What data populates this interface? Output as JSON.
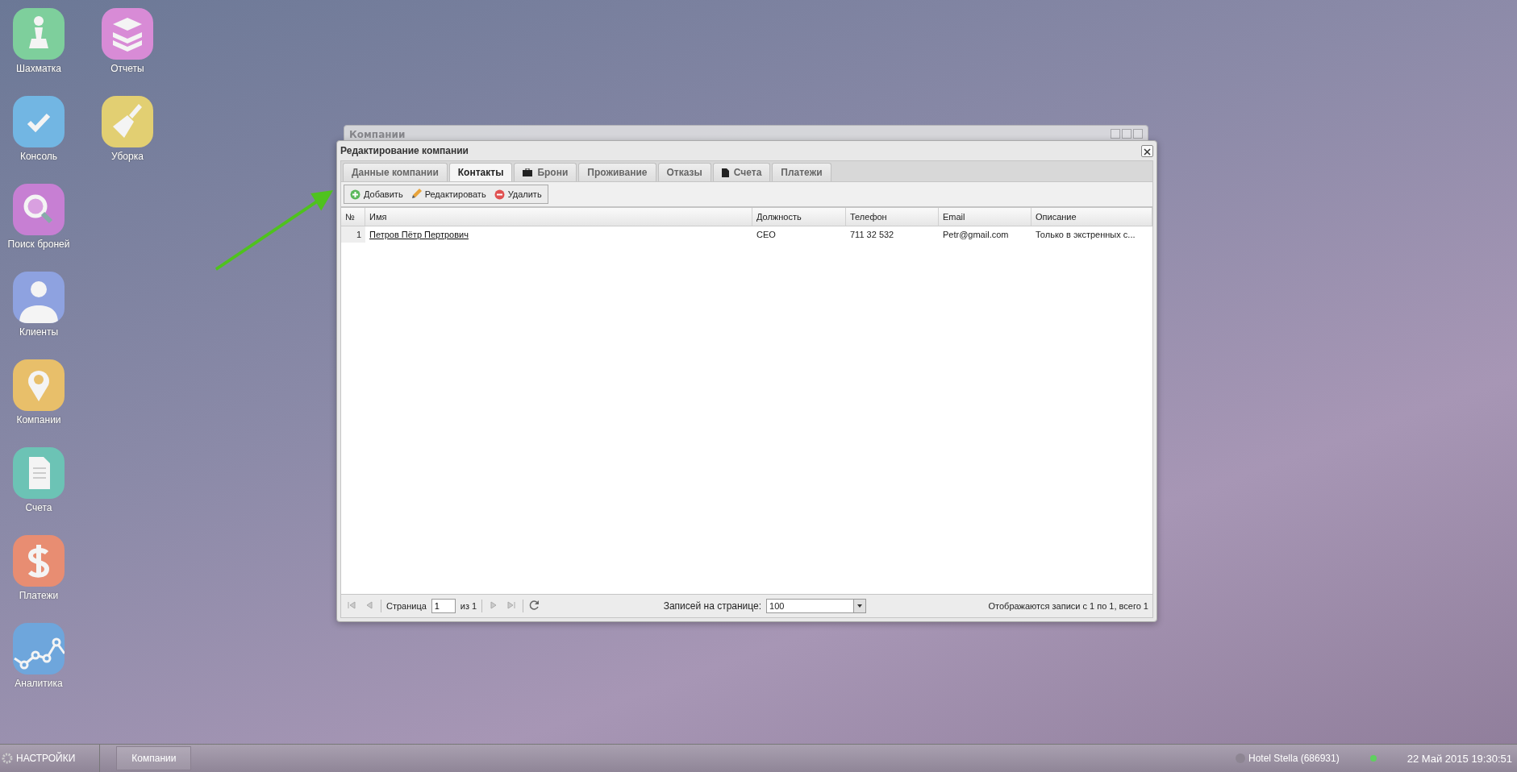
{
  "desktop_columns": [
    {
      "icons": [
        {
          "label": "Шахматка",
          "kind": "pawn"
        },
        {
          "label": "Консоль",
          "kind": "check"
        },
        {
          "label": "Поиск броней",
          "kind": "magnifier"
        },
        {
          "label": "Клиенты",
          "kind": "person"
        },
        {
          "label": "Компании",
          "kind": "pin"
        },
        {
          "label": "Счета",
          "kind": "document"
        },
        {
          "label": "Платежи",
          "kind": "dollar"
        },
        {
          "label": "Аналитика",
          "kind": "chart"
        }
      ]
    },
    {
      "icons": [
        {
          "label": "Отчеты",
          "kind": "books"
        },
        {
          "label": "Уборка",
          "kind": "broom"
        }
      ]
    }
  ],
  "background_window": {
    "title": "Компании"
  },
  "edit_window": {
    "title": "Редактирование компании",
    "tabs": [
      {
        "label": "Данные компании",
        "kind": "plain",
        "selected": false
      },
      {
        "label": "Контакты",
        "kind": "plain",
        "selected": true
      },
      {
        "label": "Брони",
        "kind": "briefcase",
        "selected": false
      },
      {
        "label": "Проживание",
        "kind": "plain",
        "selected": false
      },
      {
        "label": "Отказы",
        "kind": "plain",
        "selected": false
      },
      {
        "label": "Счета",
        "kind": "document",
        "selected": false
      },
      {
        "label": "Платежи",
        "kind": "plain",
        "selected": false
      }
    ],
    "toolbar": [
      {
        "label": "Добавить",
        "kind": "add"
      },
      {
        "label": "Редактировать",
        "kind": "edit"
      },
      {
        "label": "Удалить",
        "kind": "delete"
      }
    ],
    "table": {
      "columns": [
        "№",
        "Имя",
        "Должность",
        "Телефон",
        "Email",
        "Описание"
      ],
      "rows": [
        {
          "number": "1",
          "name": "Петров Пётр Пертрович",
          "position": "CEO",
          "phone": "711 32 532",
          "email": "Petr@gmail.com",
          "description": "Только в экстренных с..."
        }
      ]
    },
    "paging": {
      "page_label": "Страница",
      "page_value": "1",
      "of_label": "из 1",
      "per_page_label": "Записей на странице:",
      "per_page_value": "100",
      "summary": "Отображаются записи с 1 по 1, всего 1"
    }
  },
  "taskbar": {
    "start_label": "НАСТРОЙКИ",
    "tasks": [
      "Компании"
    ],
    "hotel": "Hotel Stella (686931)",
    "online": true,
    "datetime": "22 Май 2015 19:30:51"
  }
}
